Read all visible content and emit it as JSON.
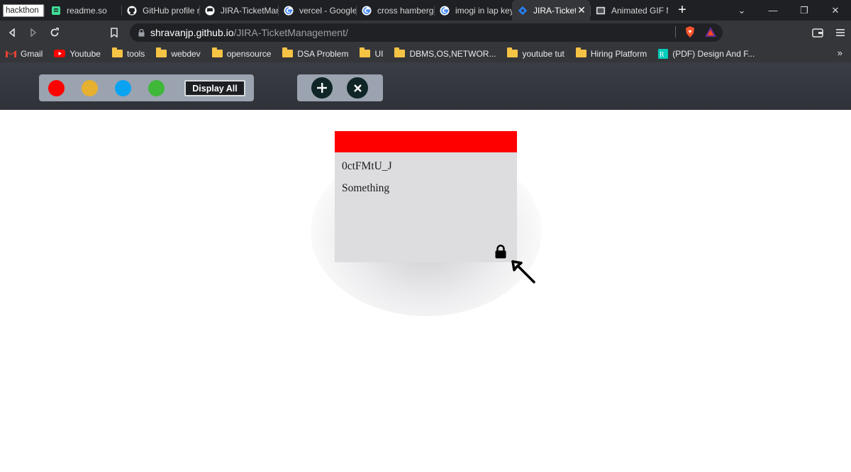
{
  "browser": {
    "tabs": [
      {
        "title": "hackthon",
        "icon": "none",
        "style": "plain"
      },
      {
        "title": "readme.so",
        "icon": "readme-icon"
      },
      {
        "title": "GitHub profile r",
        "icon": "github-icon"
      },
      {
        "title": "JIRA-TicketMan",
        "icon": "github-icon"
      },
      {
        "title": "vercel - Google",
        "icon": "google-icon"
      },
      {
        "title": "cross hamberge",
        "icon": "google-icon"
      },
      {
        "title": "imogi in lap key",
        "icon": "google-icon"
      },
      {
        "title": "JIRA-Ticket",
        "icon": "jira-icon",
        "active": true
      },
      {
        "title": "Animated GIF M",
        "icon": "gif-icon"
      }
    ],
    "url_host": "shravanjp.github.io",
    "url_path": "/JIRA-TicketManagement/",
    "bookmarks": [
      {
        "label": "Gmail",
        "icon": "gmail-icon"
      },
      {
        "label": "Youtube",
        "icon": "youtube-icon"
      },
      {
        "label": "tools",
        "icon": "folder-icon"
      },
      {
        "label": "webdev",
        "icon": "folder-icon"
      },
      {
        "label": "opensource",
        "icon": "folder-icon"
      },
      {
        "label": "DSA Problem",
        "icon": "folder-icon"
      },
      {
        "label": "UI",
        "icon": "folder-icon"
      },
      {
        "label": "DBMS,OS,NETWOR...",
        "icon": "folder-icon"
      },
      {
        "label": "youtube tut",
        "icon": "folder-icon"
      },
      {
        "label": "Hiring Platform",
        "icon": "folder-icon"
      },
      {
        "label": "(PDF) Design And F...",
        "icon": "researchgate-icon"
      }
    ],
    "bookmarks_overflow": "»"
  },
  "app": {
    "filter_colors": [
      "#ff0000",
      "#e6b030",
      "#0aa3f2",
      "#3fb83a"
    ],
    "display_all_label": "Display All",
    "add_icon": "plus-icon",
    "remove_icon": "cross-icon"
  },
  "ticket": {
    "color": "#ff0000",
    "id": "0ctFMtU_J",
    "task": "Something",
    "lock_icon": "lock-icon"
  }
}
